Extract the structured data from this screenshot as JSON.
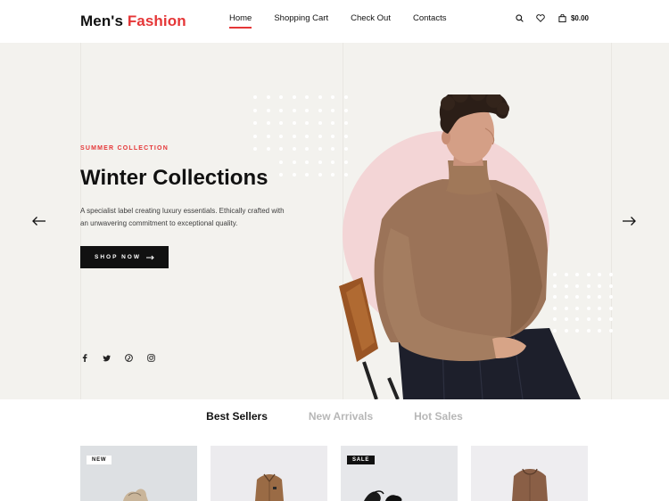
{
  "header": {
    "logo_main": "Men's",
    "logo_accent": "Fashion",
    "nav": [
      {
        "label": "Home",
        "active": true
      },
      {
        "label": "Shopping Cart",
        "active": false
      },
      {
        "label": "Check Out",
        "active": false
      },
      {
        "label": "Contacts",
        "active": false
      }
    ],
    "icons": [
      "search-icon",
      "heart-icon",
      "bag-icon"
    ],
    "cart_total": "$0.00"
  },
  "hero": {
    "eyebrow": "SUMMER COLLECTION",
    "title": "Winter Collections",
    "text": "A specialist label creating luxury essentials. Ethically crafted with an unwavering commitment to exceptional quality.",
    "button_label": "SHOP NOW",
    "social": [
      "facebook-icon",
      "twitter-icon",
      "pinterest-icon",
      "instagram-icon"
    ],
    "accent_color": "#e53637",
    "background_color": "#f3f2ee"
  },
  "tabs": [
    {
      "label": "Best Sellers",
      "active": true
    },
    {
      "label": "New Arrivals",
      "active": false
    },
    {
      "label": "Hot Sales",
      "active": false
    }
  ],
  "products": [
    {
      "badge": "NEW",
      "badge_style": "new"
    },
    {
      "badge": "",
      "badge_style": ""
    },
    {
      "badge": "SALE",
      "badge_style": "sale"
    },
    {
      "badge": "",
      "badge_style": ""
    }
  ]
}
